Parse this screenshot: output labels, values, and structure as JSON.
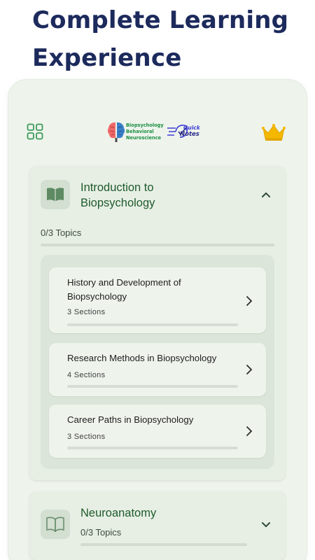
{
  "headline": "Complete Learning Experience",
  "header": {
    "menu_icon": "grid-icon",
    "premium_icon": "crown-icon",
    "logo": {
      "line1": "Biopsychology",
      "line2": "Behavioral",
      "line3": "Neuroscience",
      "quick": "Quick",
      "notes": "Notes"
    }
  },
  "modules": [
    {
      "title": "Introduction to Biopsychology",
      "topics": "0/3 Topics",
      "progress": 0,
      "expanded": true,
      "icon": "book-open-icon",
      "lessons": [
        {
          "title": "History and Development of Biopsychology",
          "sections": "3 Sections",
          "progress": 0
        },
        {
          "title": "Research Methods in Biopsychology",
          "sections": "4 Sections",
          "progress": 0
        },
        {
          "title": "Career Paths in Biopsychology",
          "sections": "3 Sections",
          "progress": 0
        }
      ]
    },
    {
      "title": "Neuroanatomy",
      "topics": "0/3 Topics",
      "progress": 0,
      "expanded": false,
      "icon": "book-open-icon"
    }
  ],
  "colors": {
    "headline": "#1c2a5c",
    "accent_green": "#1f5a2a",
    "crown": "#f5b800",
    "background_card": "#eef4ec"
  }
}
